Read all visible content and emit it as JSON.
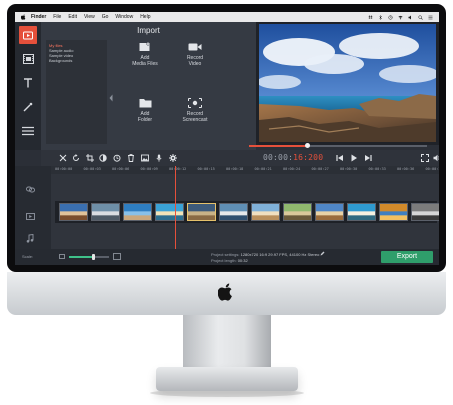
{
  "menubar": {
    "items": [
      "Finder",
      "File",
      "Edit",
      "View",
      "Go",
      "Window",
      "Help"
    ]
  },
  "sidebar": {
    "tools": [
      "import-icon",
      "filters-icon",
      "titles-icon",
      "stickers-icon",
      "more-icon"
    ]
  },
  "import_panel": {
    "title": "Import",
    "categories": [
      "My files",
      "Sample audio",
      "Sample video",
      "Backgrounds"
    ],
    "buttons": {
      "add_media": "Add\nMedia Files",
      "record_video": "Record\nVideo",
      "add_folder": "Add\nFolder",
      "record_screencast": "Record\nScreencast"
    }
  },
  "player": {
    "timecode_elapsed": "00:00:",
    "timecode_frames": "16:200",
    "progress": 0.33
  },
  "timeline": {
    "ruler_ticks": [
      "00:00:00",
      "00:00:03",
      "00:00:06",
      "00:00:09",
      "00:00:12",
      "00:00:15",
      "00:00:18",
      "00:00:21",
      "00:00:24",
      "00:00:27",
      "00:00:30",
      "00:00:33",
      "00:00:36",
      "00:00:39"
    ],
    "clip_count": 12,
    "selected_clip_index": 4
  },
  "bottom": {
    "scale_label": "Scale:",
    "zoom_level": 0.6,
    "project_settings_label": "Project settings:",
    "project_settings_value": "1280x720 16:9 29.97 FPS, 44100 Hz Stereo",
    "project_length_label": "Project length:",
    "project_length_value": "00:32",
    "export_label": "Export"
  },
  "colors": {
    "accent": "#e5503b",
    "export": "#2f9e6b",
    "zoom": "#3fc18a"
  }
}
